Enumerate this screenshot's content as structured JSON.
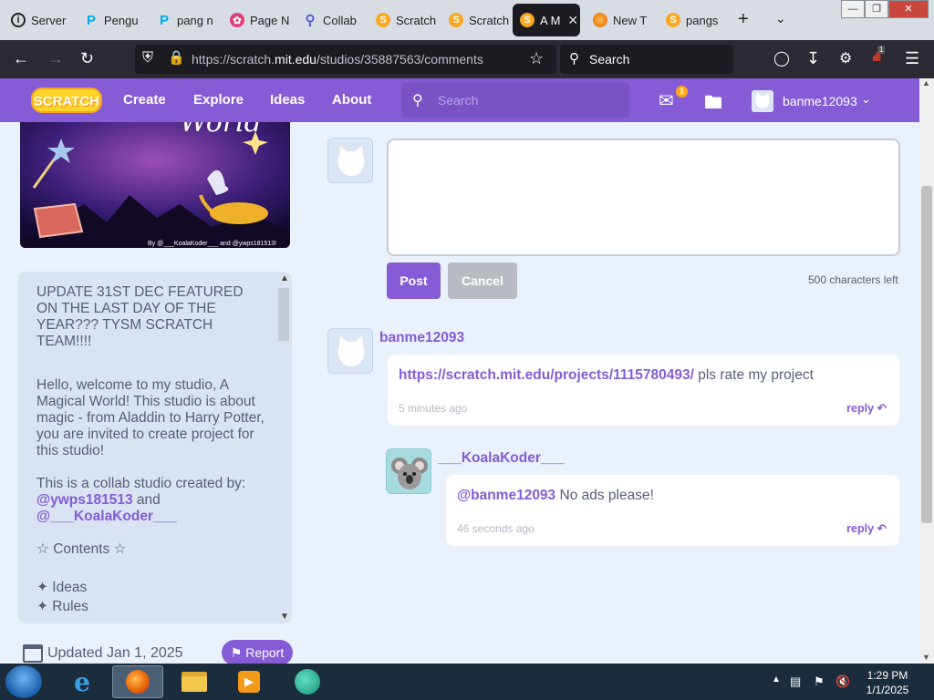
{
  "browser": {
    "tabs": [
      {
        "label": "Server",
        "icon": "info-circle-icon",
        "color": "#222222"
      },
      {
        "label": "Pengu",
        "icon": "penguinmod-icon",
        "color": "#00c3ff"
      },
      {
        "label": "pang n",
        "icon": "penguinmod-icon",
        "color": "#00c3ff"
      },
      {
        "label": "Page N",
        "icon": "flower-icon",
        "color": "#e0407b"
      },
      {
        "label": "Collab",
        "icon": "search-magnifier-icon",
        "color": "#4a5de0"
      },
      {
        "label": "Scratch",
        "icon": "scratch-cat-icon",
        "color": "#f9a825"
      },
      {
        "label": "Scratch",
        "icon": "scratch-cat-icon",
        "color": "#f9a825"
      },
      {
        "label": "A M",
        "icon": "scratch-cat-icon",
        "color": "#f9a825"
      },
      {
        "label": "New T",
        "icon": "firefox-icon",
        "color": "#e66000"
      },
      {
        "label": "pangs",
        "icon": "scratch-cat-icon",
        "color": "#f9a825"
      }
    ],
    "url_prefix": "https://scratch.",
    "url_domain": "mit.edu",
    "url_path": "/studios/35887563/comments",
    "search_label": "Search",
    "ext_badge": "1"
  },
  "header": {
    "logo": "SCRATCH",
    "nav": [
      "Create",
      "Explore",
      "Ideas",
      "About"
    ],
    "search_placeholder": "Search",
    "messages_count": "1",
    "username": "banme12093",
    "brand_color": "#855cd6"
  },
  "studio": {
    "thumbnail_title": "World",
    "thumbnail_credit": "By @___KoalaKoder___ and @ywps181513!",
    "description": {
      "update": "UPDATE 31ST DEC FEATURED ON THE LAST DAY OF THE YEAR??? TYSM SCRATCH TEAM!!!!",
      "intro": "Hello, welcome to my studio, A Magical World! This studio is about magic - from Aladdin to Harry Potter, you are invited to create project for this studio!",
      "collab_prefix": "This is a collab studio created by: ",
      "collab_user1": "@ywps181513",
      "collab_and": " and ",
      "collab_user2": "@___KoalaKoder___",
      "contents_heading": "☆ Contents ☆",
      "items": [
        "✦ Ideas",
        "✦ Rules"
      ]
    },
    "updated": "Updated Jan 1, 2025",
    "report_label": "Report"
  },
  "comments": {
    "compose_value": "",
    "post_label": "Post",
    "cancel_label": "Cancel",
    "chars_left": "500 characters left",
    "list": [
      {
        "user": "banme12093",
        "link": "https://scratch.mit.edu/projects/1115780493/",
        "text": " pls rate my project",
        "time": "5 minutes ago",
        "reply": "reply"
      },
      {
        "user": "___KoalaKoder___",
        "link": "@banme12093",
        "text": " No ads please!",
        "time": "46 seconds ago",
        "reply": "reply"
      }
    ]
  },
  "taskbar": {
    "time": "1:29 PM",
    "date": "1/1/2025"
  }
}
